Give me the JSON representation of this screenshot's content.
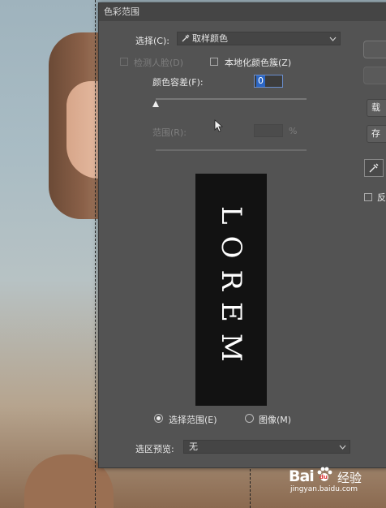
{
  "dialog": {
    "title": "色彩范围",
    "select_label": "选择(C):",
    "select_value": "取样颜色",
    "detect_faces_label": "检测人脸(D)",
    "localized_clusters_label": "本地化颜色簇(Z)",
    "fuzziness_label": "颜色容差(F):",
    "fuzziness_value": "0",
    "range_label": "范围(R):",
    "range_unit": "%",
    "preview_text": "LOREM",
    "radio_selection_label": "选择范围(E)",
    "radio_image_label": "图像(M)",
    "selection_preview_label": "选区预览:",
    "selection_preview_value": "无",
    "side_load_label": "载",
    "side_save_label": "存",
    "invert_label": "反"
  },
  "watermark": {
    "brand_a": "Bai",
    "brand_b": "du",
    "brand_cn": "经验",
    "url": "jingyan.baidu.com"
  },
  "colors": {
    "dialog_bg": "#535353",
    "titlebar_bg": "#454545",
    "field_highlight": "#2b66c5",
    "preview_bg": "#121212"
  }
}
